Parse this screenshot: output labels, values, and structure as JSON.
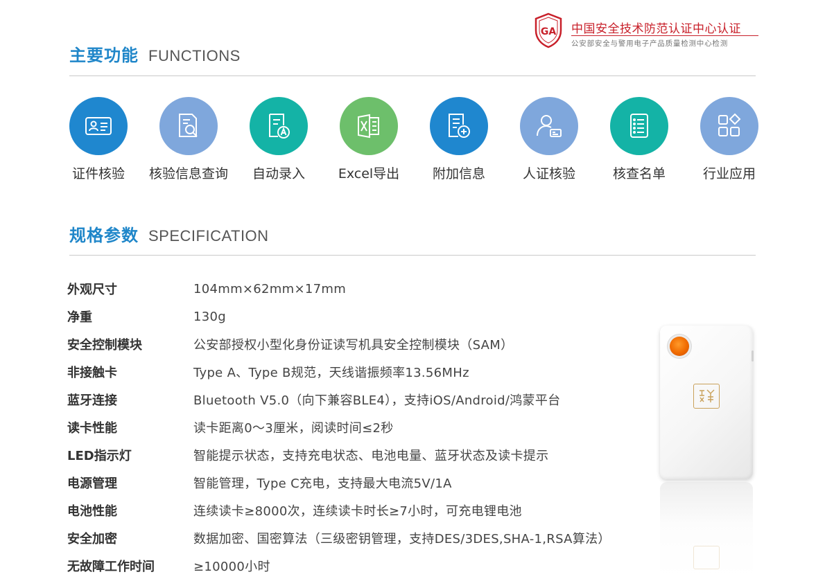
{
  "certification": {
    "badge_text": "GA",
    "title": "中国安全技术防范认证中心认证",
    "subtitle": "公安部安全与警用电子产品质量检测中心检测",
    "color": "#c8202a"
  },
  "functions_section": {
    "title_cn": "主要功能",
    "title_en": "FUNCTIONS",
    "items": [
      {
        "label": "证件核验",
        "icon": "id-card-icon",
        "color": "#1f87cf"
      },
      {
        "label": "核验信息查询",
        "icon": "document-search-icon",
        "color": "#7fa7dc"
      },
      {
        "label": "自动录入",
        "icon": "auto-entry-icon",
        "color": "#14b3a6"
      },
      {
        "label": "Excel导出",
        "icon": "excel-icon",
        "color": "#6dbf6b"
      },
      {
        "label": "附加信息",
        "icon": "add-document-icon",
        "color": "#1f87cf"
      },
      {
        "label": "人证核验",
        "icon": "person-verify-icon",
        "color": "#7fa7dc"
      },
      {
        "label": "核查名单",
        "icon": "checklist-icon",
        "color": "#14b3a6"
      },
      {
        "label": "行业应用",
        "icon": "apps-grid-icon",
        "color": "#7fa7dc"
      }
    ]
  },
  "spec_section": {
    "title_cn": "规格参数",
    "title_en": "SPECIFICATION",
    "rows": [
      {
        "key": "外观尺寸",
        "value": "104mm×62mm×17mm"
      },
      {
        "key": "净重",
        "value": "130g"
      },
      {
        "key": "安全控制模块",
        "value": "公安部授权小型化身份证读写机具安全控制模块（SAM）"
      },
      {
        "key": "非接触卡",
        "value": "Type A、Type B规范，天线谐振频率13.56MHz"
      },
      {
        "key": "蓝牙连接",
        "value": "Bluetooth V5.0（向下兼容BLE4），支持iOS/Android/鸿蒙平台"
      },
      {
        "key": "读卡性能",
        "value": "读卡距离0～3厘米，阅读时间≤2秒"
      },
      {
        "key": "LED指示灯",
        "value": "智能提示状态，支持充电状态、电池电量、蓝牙状态及读卡提示"
      },
      {
        "key": "电源管理",
        "value": "智能管理，Type C充电，支持最大电流5V/1A"
      },
      {
        "key": "电池性能",
        "value": "连续读卡≥8000次，连续读卡时长≥7小时，可充电锂电池"
      },
      {
        "key": "安全加密",
        "value": "数据加密、国密算法（三级密钥管理，支持DES/3DES,SHA-1,RSA算法）"
      },
      {
        "key": "无故障工作时间",
        "value": "≥10000小时"
      }
    ]
  },
  "colors": {
    "heading_blue": "#1f86c9",
    "rule_gray": "#c9c9c9"
  }
}
